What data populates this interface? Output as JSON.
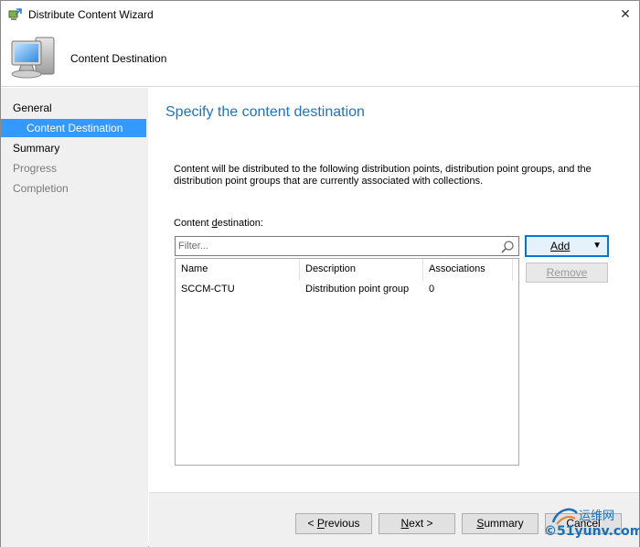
{
  "window": {
    "title": "Distribute Content Wizard",
    "close_glyph": "✕"
  },
  "header": {
    "title": "Content Destination"
  },
  "sidebar": {
    "items": [
      {
        "label": "General",
        "state": "normal"
      },
      {
        "label": "Content Destination",
        "state": "active"
      },
      {
        "label": "Summary",
        "state": "normal"
      },
      {
        "label": "Progress",
        "state": "disabled"
      },
      {
        "label": "Completion",
        "state": "disabled"
      }
    ]
  },
  "main": {
    "heading": "Specify the content destination",
    "description": "Content will be distributed to the following distribution points, distribution point groups, and the distribution point groups that are currently associated with collections.",
    "destination_label_pre": "Content ",
    "destination_label_key": "d",
    "destination_label_post": "estination:",
    "filter": {
      "placeholder": "Filter...",
      "value": ""
    },
    "table": {
      "columns": [
        "Name",
        "Description",
        "Associations"
      ],
      "rows": [
        [
          "SCCM-CTU",
          "Distribution point group",
          "0"
        ]
      ]
    },
    "add_label": "Add",
    "add_arrow": "▼",
    "remove_label": "Remove"
  },
  "footer": {
    "previous_prefix": "< ",
    "previous_key": "P",
    "previous_rest": "revious",
    "next_key": "N",
    "next_rest": "ext >",
    "summary_key": "S",
    "summary_rest": "ummary",
    "cancel_label": "Cancel"
  },
  "watermark": {
    "top": "运维网",
    "bottom": "©51yunv.com"
  },
  "colors": {
    "accent": "#3399ff",
    "heading": "#1e73be"
  }
}
